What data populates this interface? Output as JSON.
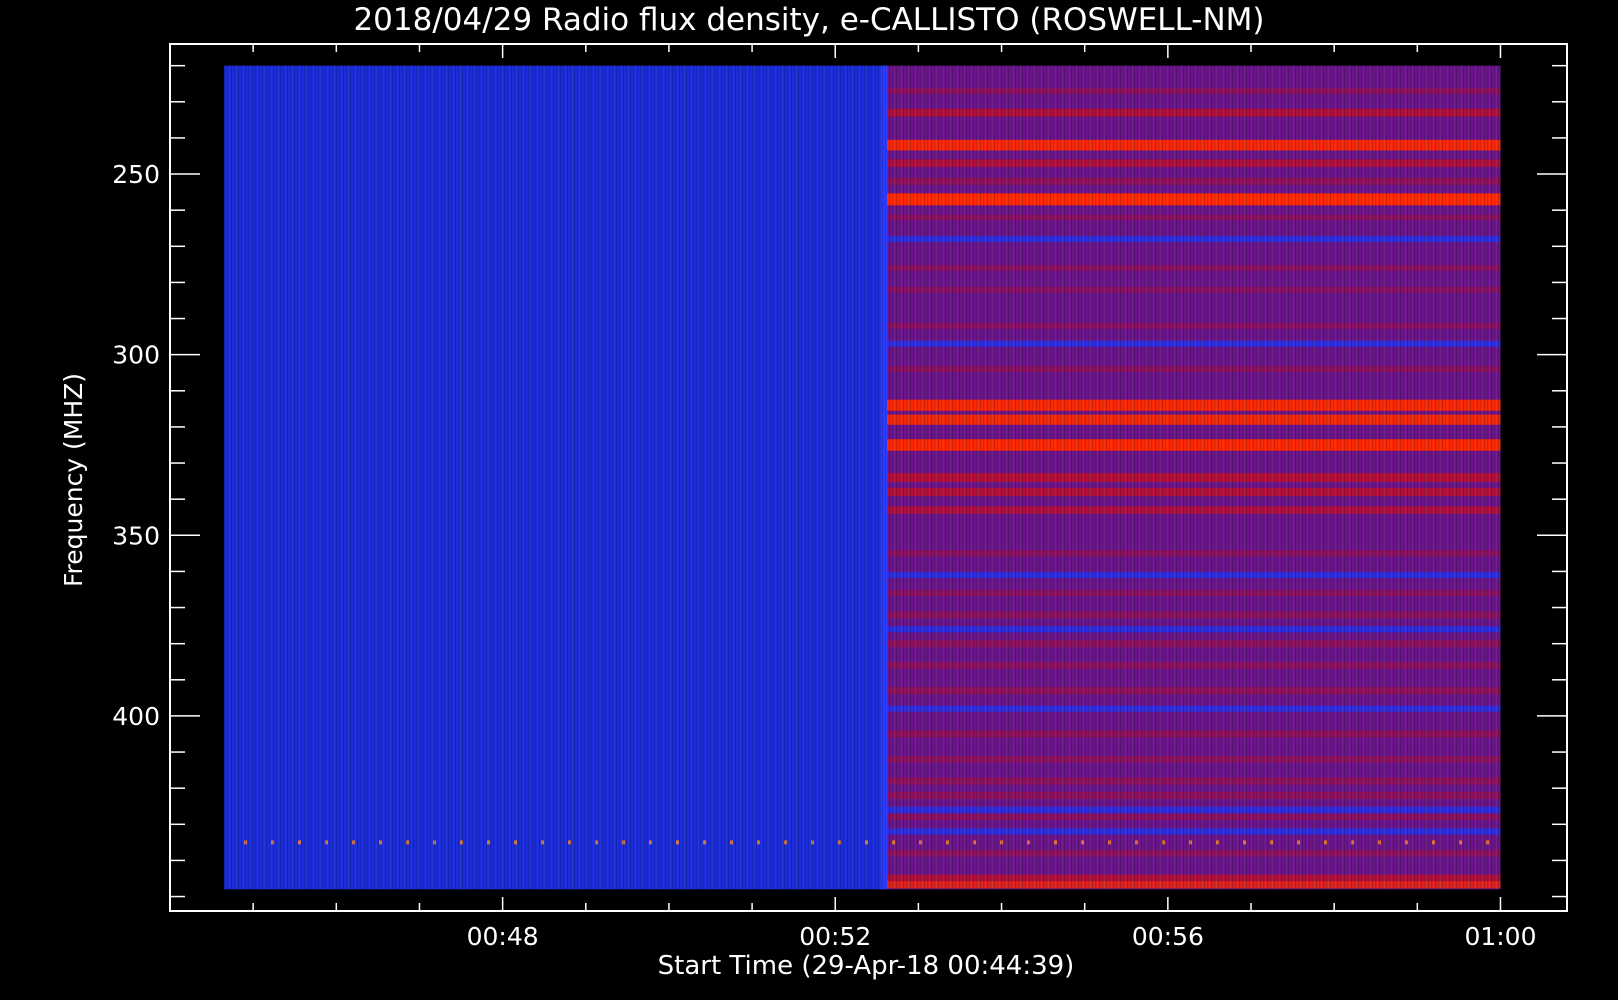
{
  "chart_data": {
    "type": "heatmap",
    "title": "2018/04/29  Radio flux density, e-CALLISTO (ROSWELL-NM)",
    "xlabel": "Start Time (29-Apr-18 00:44:39)",
    "ylabel": "Frequency (MHZ)",
    "x_ticks": [
      "00:48",
      "00:52",
      "00:56",
      "01:00"
    ],
    "x_tick_minutes": [
      48,
      52,
      56,
      60
    ],
    "x_minor_step_minutes": 1,
    "x_axis_range_minutes": [
      44.0,
      60.8
    ],
    "data_time_range_minutes": [
      44.65,
      60.0
    ],
    "transition_minute": 52.6,
    "y_ticks": [
      "250",
      "300",
      "350",
      "400"
    ],
    "y_tick_values": [
      250,
      300,
      350,
      400
    ],
    "y_minor_step": 10,
    "y_axis_range_mhz": [
      214,
      454
    ],
    "data_freq_range_mhz": [
      220,
      448
    ],
    "y_inverted": true,
    "background_color": "#1a2dd8",
    "quiet_color": "#1a2dd8",
    "active_color": "#6a168a",
    "hot_color": "#ff2a00",
    "bright_bands_mhz": [
      {
        "freq": 227,
        "intensity": 0.35
      },
      {
        "freq": 233,
        "intensity": 0.55
      },
      {
        "freq": 242,
        "intensity": 0.85
      },
      {
        "freq": 247,
        "intensity": 0.5
      },
      {
        "freq": 252,
        "intensity": 0.45
      },
      {
        "freq": 257,
        "intensity": 1.0
      },
      {
        "freq": 262,
        "intensity": 0.3
      },
      {
        "freq": 276,
        "intensity": 0.3
      },
      {
        "freq": 282,
        "intensity": 0.3
      },
      {
        "freq": 292,
        "intensity": 0.3
      },
      {
        "freq": 304,
        "intensity": 0.3
      },
      {
        "freq": 314,
        "intensity": 0.9
      },
      {
        "freq": 318,
        "intensity": 0.8
      },
      {
        "freq": 325,
        "intensity": 0.95
      },
      {
        "freq": 334,
        "intensity": 0.65
      },
      {
        "freq": 338,
        "intensity": 0.6
      },
      {
        "freq": 343,
        "intensity": 0.5
      },
      {
        "freq": 355,
        "intensity": 0.35
      },
      {
        "freq": 366,
        "intensity": 0.3
      },
      {
        "freq": 372,
        "intensity": 0.4
      },
      {
        "freq": 380,
        "intensity": 0.45
      },
      {
        "freq": 386,
        "intensity": 0.4
      },
      {
        "freq": 393,
        "intensity": 0.45
      },
      {
        "freq": 405,
        "intensity": 0.45
      },
      {
        "freq": 412,
        "intensity": 0.4
      },
      {
        "freq": 418,
        "intensity": 0.45
      },
      {
        "freq": 422,
        "intensity": 0.45
      },
      {
        "freq": 428,
        "intensity": 0.3
      },
      {
        "freq": 438,
        "intensity": 0.4
      },
      {
        "freq": 445,
        "intensity": 0.55
      }
    ],
    "blue_bands_mhz": [
      268,
      297,
      361,
      376,
      398,
      426,
      432
    ],
    "interference_line_mhz": 435
  }
}
